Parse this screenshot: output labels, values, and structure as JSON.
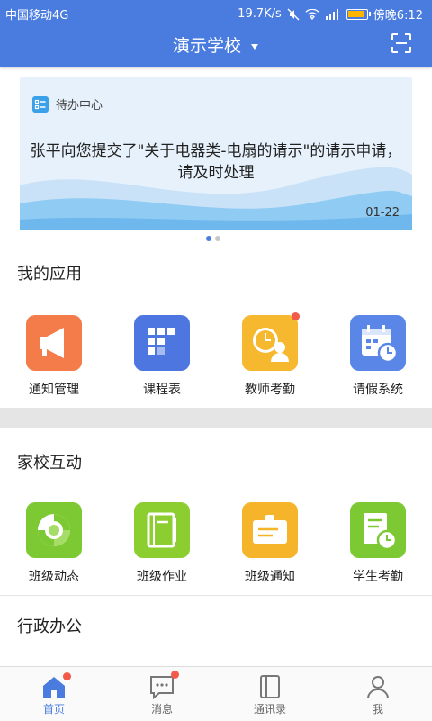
{
  "status_bar": {
    "carrier": "中国移动4G",
    "speed": "19.7K/s",
    "time": "傍晚6:12",
    "battery_level": 0.85
  },
  "header": {
    "title": "演示学校",
    "dropdown_icon": "caret-down-icon",
    "scan_icon": "scan-icon"
  },
  "banner": {
    "section_label": "待办中心",
    "message": "张平向您提交了\"关于电器类-电扇的请示\"的请示申请，请及时处理",
    "date": "01-22",
    "page_count": 2,
    "active_page": 1
  },
  "my_apps": {
    "title": "我的应用",
    "items": [
      {
        "label": "通知管理",
        "icon": "megaphone-icon",
        "color": "#f37c4a",
        "badge": false
      },
      {
        "label": "课程表",
        "icon": "grid-icon",
        "color": "#4d76e0",
        "badge": false
      },
      {
        "label": "教师考勤",
        "icon": "clock-person-icon",
        "color": "#f5b82e",
        "badge": true
      },
      {
        "label": "请假系统",
        "icon": "calendar-clock-icon",
        "color": "#5a86e8",
        "badge": false
      }
    ]
  },
  "home_school": {
    "title": "家校互动",
    "items": [
      {
        "label": "班级动态",
        "icon": "swirl-icon",
        "color": "#7cc934"
      },
      {
        "label": "班级作业",
        "icon": "notebook-icon",
        "color": "#8ccd2f"
      },
      {
        "label": "班级通知",
        "icon": "id-card-icon",
        "color": "#f5b42a"
      },
      {
        "label": "学生考勤",
        "icon": "document-clock-icon",
        "color": "#7cc934"
      }
    ]
  },
  "admin": {
    "title": "行政办公"
  },
  "tabs": [
    {
      "label": "首页",
      "icon": "home-icon",
      "active": true,
      "badge": true
    },
    {
      "label": "消息",
      "icon": "message-icon",
      "active": false,
      "badge": true
    },
    {
      "label": "通讯录",
      "icon": "contacts-icon",
      "active": false,
      "badge": false
    },
    {
      "label": "我",
      "icon": "person-icon",
      "active": false,
      "badge": false
    }
  ],
  "colors": {
    "primary": "#4a7cdf",
    "badge": "#f25a4a",
    "separator": "#e5e5e5"
  }
}
